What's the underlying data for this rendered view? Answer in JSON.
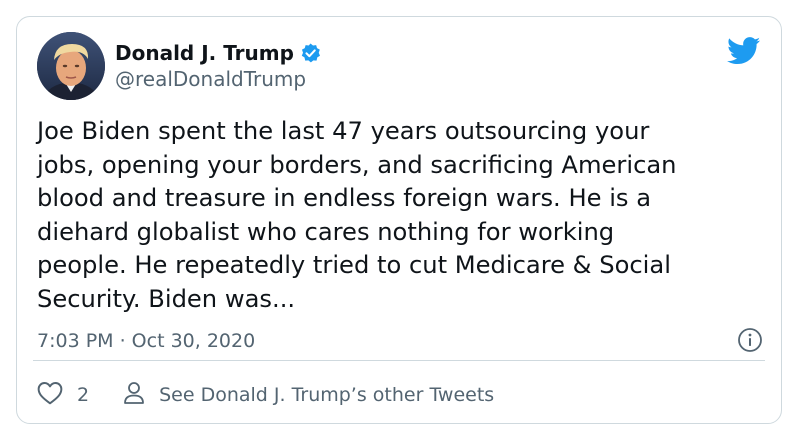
{
  "author": {
    "display_name": "Donald J. Trump",
    "handle": "@realDonaldTrump",
    "verified": true
  },
  "tweet": {
    "lines": [
      "Joe Biden spent the last 47 years outsourcing your",
      "jobs, opening your borders, and sacrificing American",
      "blood and treasure in endless foreign wars. He is a",
      "diehard globalist who cares nothing for working",
      "people. He repeatedly tried to cut Medicare & Social",
      "Security. Biden was..."
    ],
    "timestamp": "7:03 PM · Oct 30, 2020"
  },
  "actions": {
    "like_count": "2",
    "profile_link_label": "See Donald J. Trump’s other Tweets"
  },
  "icons": {
    "brand": "twitter-bird-icon",
    "verified": "verified-badge-icon",
    "info": "info-icon",
    "like": "heart-icon",
    "profile": "person-icon"
  },
  "colors": {
    "brand_blue": "#1d9bf0",
    "text_primary": "#0f1419",
    "text_secondary": "#536471",
    "border": "#cfd9de"
  }
}
